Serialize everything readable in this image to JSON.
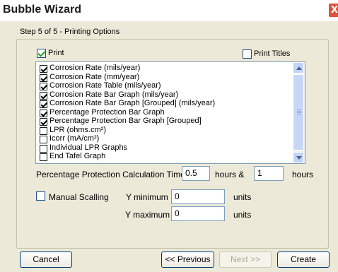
{
  "window": {
    "title": "Bubble Wizard",
    "close_glyph": "X"
  },
  "step_label": "Step 5 of 5 - Printing Options",
  "print": {
    "label": "Print",
    "checked": true
  },
  "print_titles": {
    "label": "Print Titles",
    "checked": false
  },
  "report_items": [
    {
      "label": "Corrosion Rate (mils/year)",
      "checked": true
    },
    {
      "label": "Corrosion Rate (mm/year)",
      "checked": true
    },
    {
      "label": "Corrosion Rate Table (mils/year)",
      "checked": true
    },
    {
      "label": "Corrosion Rate Bar Graph (mils/year)",
      "checked": true
    },
    {
      "label": "Corrosion Rate Bar Graph [Grouped] (mils/year)",
      "checked": true
    },
    {
      "label": "Percentage Protection Bar Graph",
      "checked": true
    },
    {
      "label": "Percentage Protection Bar Graph [Grouped]",
      "checked": true
    },
    {
      "label": "LPR (ohms.cm²)",
      "checked": false
    },
    {
      "label": "Icorr (mA/cm²)",
      "checked": false
    },
    {
      "label": "Individual LPR Graphs",
      "checked": false
    },
    {
      "label": "End Tafel Graph",
      "checked": false
    }
  ],
  "calc_times": {
    "label": "Percentage Protection Calculation Times",
    "value1": "0.5",
    "unit1": "hours &",
    "value2": "1",
    "unit2": "hours"
  },
  "manual_scaling": {
    "label": "Manual Scalling",
    "checked": false
  },
  "y_minimum": {
    "label": "Y minimum",
    "value": "0",
    "unit": "units"
  },
  "y_maximum": {
    "label": "Y maximum",
    "value": "0",
    "unit": "units"
  },
  "buttons": {
    "cancel": "Cancel",
    "previous": "<< Previous",
    "next": "Next >>",
    "create": "Create"
  }
}
